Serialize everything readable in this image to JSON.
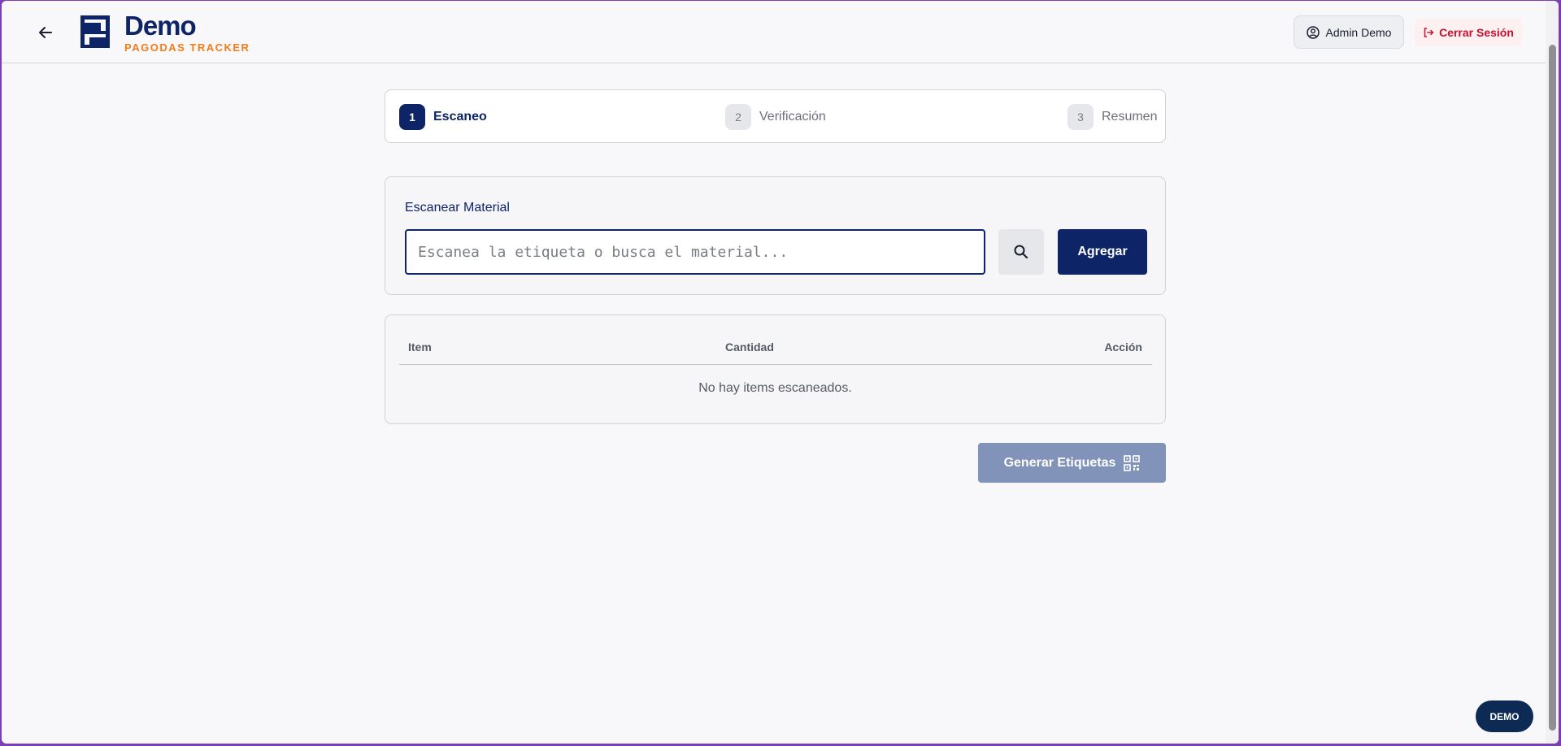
{
  "header": {
    "brand_name": "Demo",
    "brand_subtitle": "PAGODAS TRACKER",
    "user_label": "Admin Demo",
    "logout_label": "Cerrar Sesión"
  },
  "stepper": {
    "steps": [
      {
        "number": "1",
        "label": "Escaneo",
        "active": true
      },
      {
        "number": "2",
        "label": "Verificación",
        "active": false
      },
      {
        "number": "3",
        "label": "Resumen",
        "active": false
      }
    ]
  },
  "scan": {
    "label": "Escanear Material",
    "input_value": "",
    "placeholder": "Escanea la etiqueta o busca el material...",
    "add_label": "Agregar"
  },
  "table": {
    "columns": [
      "Item",
      "Cantidad",
      "Acción"
    ],
    "rows": [],
    "empty_message": "No hay items escaneados."
  },
  "actions": {
    "generate_label": "Generar Etiquetas"
  },
  "badge": {
    "label": "DEMO"
  },
  "colors": {
    "primary": "#0d2466",
    "accent": "#f07c1a",
    "danger": "#c8102e",
    "disabled_button": "#8293b9"
  },
  "icons": [
    "arrow-left-icon",
    "logo-icon",
    "user-circle-icon",
    "logout-icon",
    "search-icon",
    "qr-code-icon"
  ]
}
